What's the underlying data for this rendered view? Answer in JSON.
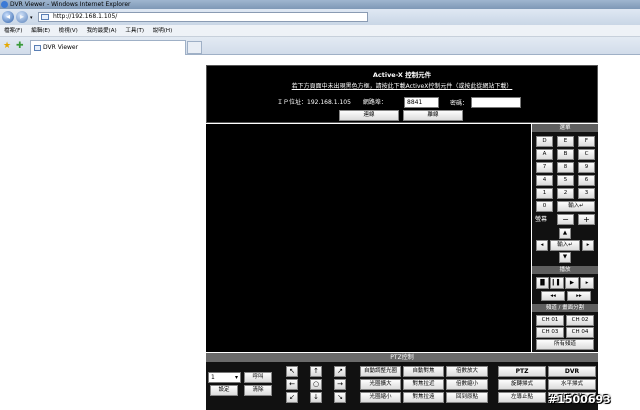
{
  "window": {
    "title": "DVR Viewer - Windows Internet Explorer"
  },
  "address": {
    "url": "http://192.168.1.105/"
  },
  "menu": [
    "檔案(F)",
    "編輯(E)",
    "檢視(V)",
    "我的最愛(A)",
    "工具(T)",
    "說明(H)"
  ],
  "tab": {
    "label": "DVR Viewer"
  },
  "activex": {
    "title": "Active-X 控制元件",
    "warning": "若下方頁面中未出現黑色方框，請按此下載ActiveX控制元件（或按此從網站下載）",
    "ip_label": "ＩＰ位址：192.168.1.105",
    "port_label": "網路埠：",
    "port_value": "8841",
    "password_label": "密碼：",
    "connect": "連線",
    "disconnect": "離線"
  },
  "sidebar": {
    "selector_title": "選單",
    "keys": [
      "D",
      "E",
      "F",
      "A",
      "B",
      "C",
      "7",
      "8",
      "9",
      "4",
      "5",
      "6",
      "1",
      "2",
      "3",
      "0"
    ],
    "enter": "輸入↵",
    "screen": "螢幕",
    "minus": "−",
    "plus": "+",
    "up": "▲",
    "left": "◂",
    "dpad_enter": "輸入↵",
    "right": "▸",
    "down": "▼",
    "playback_title": "播放",
    "play_row1": [
      "▐▌",
      "▎▌",
      "▶",
      "▸"
    ],
    "play_row2": [
      "◂◂",
      "▸▸"
    ],
    "channel_title": "頻道 / 畫面分割",
    "channels": [
      "CH 01",
      "CH 02",
      "CH 03",
      "CH 04"
    ],
    "all_channels": "所有頻道"
  },
  "ptz": {
    "title": "PTZ控制",
    "select_value": "1",
    "call": "呼叫",
    "set": "設定",
    "clear": "清除",
    "arrows": [
      "↖",
      "↑",
      "↗",
      "←",
      "○",
      "→",
      "↙",
      "↓",
      "↘"
    ],
    "functions": [
      [
        "自動調整光圈",
        "自動對焦",
        "倍數放大"
      ],
      [
        "光圈擴大",
        "對焦拉近",
        "倍數縮小"
      ],
      [
        "光圈縮小",
        "對焦拉遠",
        "回到原點"
      ]
    ],
    "ptz": "PTZ",
    "dvr": "DVR",
    "right_col1": [
      "旋轉掃式",
      "左導止點"
    ],
    "right_col2": [
      "水平掃式",
      "右導止點"
    ]
  },
  "watermark": "#1500693"
}
